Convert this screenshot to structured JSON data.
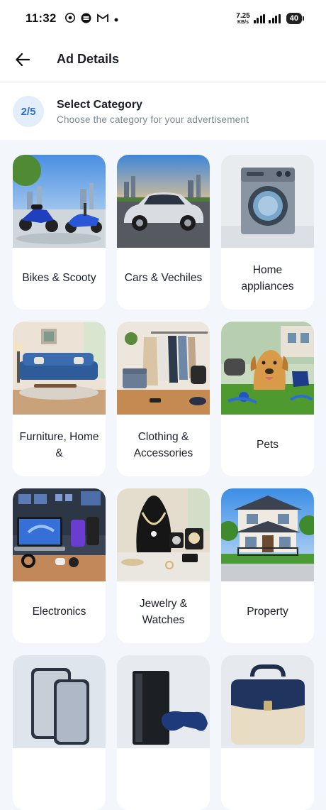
{
  "status_bar": {
    "time": "11:32",
    "net_speed_value": "7.25",
    "net_speed_unit": "KB/s",
    "battery": "40",
    "icons": [
      "chrome-icon",
      "app-icon",
      "gmail-icon",
      "dot-icon",
      "signal-icon",
      "signal-icon",
      "battery-icon"
    ]
  },
  "header": {
    "title": "Ad Details"
  },
  "step": {
    "badge": "2/5",
    "title": "Select Category",
    "subtitle": "Choose the category for your advertisement"
  },
  "categories": [
    {
      "label": "Bikes & Scooty",
      "image": "bikes"
    },
    {
      "label": "Cars & Vechiles",
      "image": "cars"
    },
    {
      "label": "Home appliances",
      "image": "appliances"
    },
    {
      "label": "Furniture, Home &",
      "image": "furniture"
    },
    {
      "label": "Clothing & Accessories",
      "image": "clothing"
    },
    {
      "label": "Pets",
      "image": "pets"
    },
    {
      "label": "Electronics",
      "image": "electronics"
    },
    {
      "label": "Jewelry & Watches",
      "image": "jewelry"
    },
    {
      "label": "Property",
      "image": "property"
    },
    {
      "label": "",
      "image": "phones"
    },
    {
      "label": "",
      "image": "gaming"
    },
    {
      "label": "",
      "image": "bags"
    }
  ]
}
